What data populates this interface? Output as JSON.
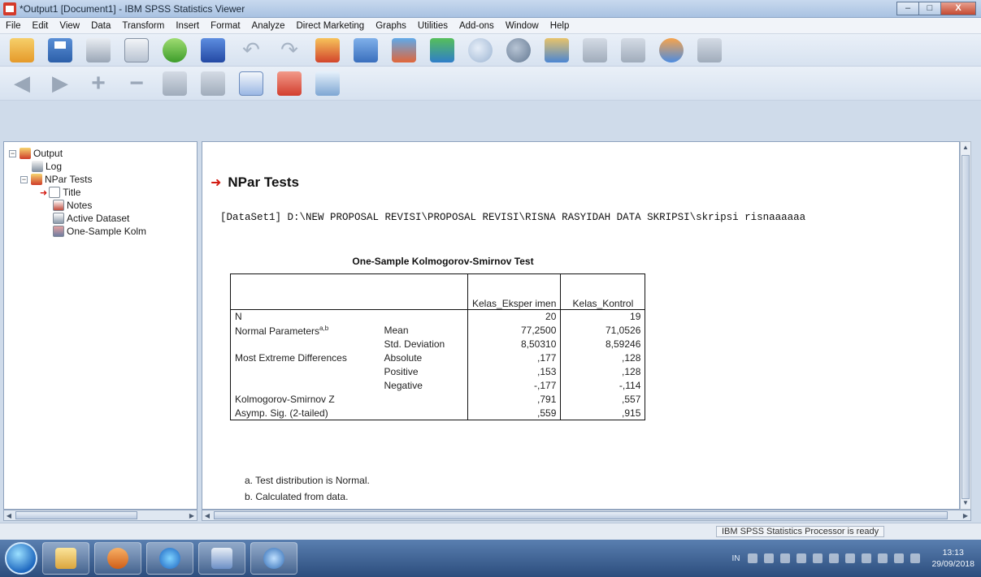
{
  "window": {
    "title": "*Output1 [Document1] - IBM SPSS Statistics Viewer",
    "controls": [
      "–",
      "□",
      "X"
    ]
  },
  "menu": [
    "File",
    "Edit",
    "View",
    "Data",
    "Transform",
    "Insert",
    "Format",
    "Analyze",
    "Direct Marketing",
    "Graphs",
    "Utilities",
    "Add-ons",
    "Window",
    "Help"
  ],
  "toolbar1_icons": [
    "open-icon",
    "save-icon",
    "print-icon",
    "print-preview-icon",
    "export-icon",
    "recall-dialog-icon",
    "undo-icon",
    "redo-icon",
    "goto-data-icon",
    "goto-case-icon",
    "variables-icon",
    "designate-window-icon",
    "show-all-icon",
    "hide-icon",
    "split-file-icon",
    "select-cases-icon",
    "value-labels-icon",
    "use-sets-icon",
    "show-variables-icon"
  ],
  "toolbar2_icons": [
    "back-arrow-icon",
    "forward-arrow-icon",
    "expand-icon",
    "collapse-icon",
    "show-icon",
    "hide-output-icon",
    "insert-heading-icon",
    "insert-title-icon",
    "insert-text-icon"
  ],
  "outline": {
    "items": [
      {
        "label": "Output",
        "level": 0,
        "icon": "output-book-icon",
        "toggle": "−"
      },
      {
        "label": "Log",
        "level": 1,
        "icon": "log-icon",
        "toggle": ""
      },
      {
        "label": "NPar Tests",
        "level": 1,
        "icon": "book-icon",
        "toggle": "−"
      },
      {
        "label": "Title",
        "level": 2,
        "icon": "title-icon",
        "toggle": "",
        "selected_arrow": true
      },
      {
        "label": "Notes",
        "level": 2,
        "icon": "notes-icon",
        "toggle": ""
      },
      {
        "label": "Active Dataset",
        "level": 2,
        "icon": "dataset-icon",
        "toggle": ""
      },
      {
        "label": "One-Sample Kolm",
        "level": 2,
        "icon": "pivot-table-icon",
        "toggle": ""
      }
    ]
  },
  "content": {
    "heading": "NPar Tests",
    "dataset_line": "[DataSet1] D:\\NEW PROPOSAL REVISI\\PROPOSAL REVISI\\RISNA RASYIDAH DATA SKRIPSI\\skripsi risnaaaaaa",
    "table": {
      "title": "One-Sample Kolmogorov-Smirnov Test",
      "columns": [
        "Kelas_Eksper imen",
        "Kelas_Kontrol"
      ],
      "rows": [
        {
          "label": "N",
          "sup": "",
          "sub": "",
          "v1": "20",
          "v2": "19"
        },
        {
          "label": "Normal Parameters",
          "sup": "a,b",
          "sub": "Mean",
          "v1": "77,2500",
          "v2": "71,0526"
        },
        {
          "label": "",
          "sup": "",
          "sub": "Std. Deviation",
          "v1": "8,50310",
          "v2": "8,59246"
        },
        {
          "label": "Most Extreme Differences",
          "sup": "",
          "sub": "Absolute",
          "v1": ",177",
          "v2": ",128"
        },
        {
          "label": "",
          "sup": "",
          "sub": "Positive",
          "v1": ",153",
          "v2": ",128"
        },
        {
          "label": "",
          "sup": "",
          "sub": "Negative",
          "v1": "-,177",
          "v2": "-,114"
        },
        {
          "label": "Kolmogorov-Smirnov Z",
          "sup": "",
          "sub": "",
          "v1": ",791",
          "v2": ",557"
        },
        {
          "label": "Asymp. Sig. (2-tailed)",
          "sup": "",
          "sub": "",
          "v1": ",559",
          "v2": ",915"
        }
      ],
      "footnotes": [
        "a. Test distribution is Normal.",
        "b. Calculated from data."
      ]
    }
  },
  "status": {
    "text": "IBM SPSS Statistics Processor is ready"
  },
  "taskbar": {
    "apps": [
      "folder-icon",
      "media-player-icon",
      "internet-explorer-icon",
      "word-icon",
      "spss-icon"
    ],
    "language": "IN",
    "time": "13:13",
    "date": "29/09/2018"
  }
}
